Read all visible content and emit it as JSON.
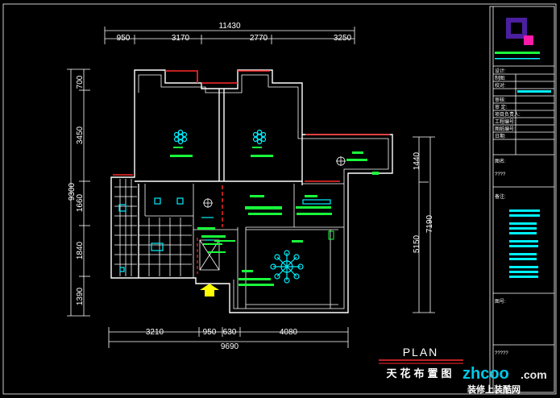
{
  "dimensions": {
    "top_total": "11430",
    "top_segments": [
      "950",
      "3170",
      "2770",
      "3250"
    ],
    "bottom_total": "9690",
    "bottom_segments": [
      "3210",
      "950",
      "630",
      "4080"
    ],
    "left_total": "9300",
    "left_segments": [
      "700",
      "3450",
      "1660",
      "1840",
      "1390"
    ],
    "right_segments": [
      "1440",
      "5150"
    ],
    "right_total": "7190"
  },
  "title": {
    "main": "PLAN",
    "sub": "天花布置图"
  },
  "title_block": {
    "fields": [
      "设计:",
      "制图:",
      "校对:",
      "审核:",
      "审  定:",
      "项目负责人:",
      "工程编号:",
      "图纸编号:",
      "日期:"
    ],
    "section_a": "图名:",
    "section_a_value": "????",
    "section_b": "备注:",
    "section_c": "图号:",
    "drawing_no": "?????"
  },
  "watermark": {
    "brand": "zhcoo",
    "domain": ".com",
    "tagline": "装修上装酷网"
  },
  "colors": {
    "background": "#000000",
    "lines": "#ffffff",
    "accent_red": "#ff2a2a",
    "text_green": "#19ff3a",
    "fixture_cyan": "#00f0ff",
    "arrow_yellow": "#ffff00",
    "logo_purple": "#4b1fa0",
    "logo_magenta": "#ff1aa8"
  }
}
